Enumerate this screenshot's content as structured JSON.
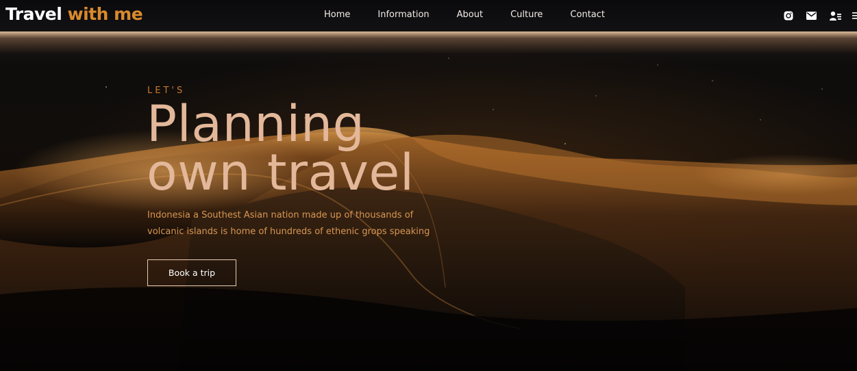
{
  "brand": {
    "title_part1": "Travel",
    "title_part2": "with me"
  },
  "nav": {
    "items": [
      {
        "label": "Home"
      },
      {
        "label": "Information"
      },
      {
        "label": "About"
      },
      {
        "label": "Culture"
      },
      {
        "label": "Contact"
      }
    ]
  },
  "header_icons": [
    "instagram-icon",
    "mail-icon",
    "user-list-icon",
    "menu-icon"
  ],
  "hero": {
    "kicker": "LET'S",
    "headline_line1": "Planning",
    "headline_line2": "own travel",
    "subtitle": "Indonesia a Southest Asian nation made up of thousands of volcanic islands is home of hundreds of ethenic grops speaking",
    "cta_label": "Book a trip"
  },
  "colors": {
    "accent_orange": "#d98a2b",
    "headline_peach": "#e3b89a",
    "subtitle_gold": "#d89752",
    "background": "#0b0908"
  }
}
